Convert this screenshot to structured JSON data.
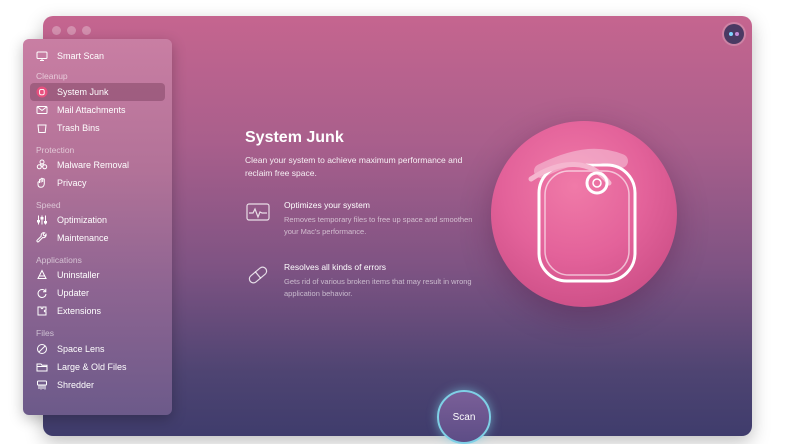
{
  "sidebar": {
    "items": [
      {
        "label": "Smart Scan",
        "icon": "monitor-icon"
      },
      {
        "label": "System Junk",
        "icon": "system-junk-icon"
      },
      {
        "label": "Mail Attachments",
        "icon": "mail-icon"
      },
      {
        "label": "Trash Bins",
        "icon": "trash-icon"
      },
      {
        "label": "Malware Removal",
        "icon": "biohazard-icon"
      },
      {
        "label": "Privacy",
        "icon": "hand-icon"
      },
      {
        "label": "Optimization",
        "icon": "sliders-icon"
      },
      {
        "label": "Maintenance",
        "icon": "wrench-icon"
      },
      {
        "label": "Uninstaller",
        "icon": "apps-icon"
      },
      {
        "label": "Updater",
        "icon": "refresh-icon"
      },
      {
        "label": "Extensions",
        "icon": "extensions-icon"
      },
      {
        "label": "Space Lens",
        "icon": "lens-icon"
      },
      {
        "label": "Large & Old Files",
        "icon": "folder-icon"
      },
      {
        "label": "Shredder",
        "icon": "shredder-icon"
      }
    ],
    "sections": {
      "cleanup": "Cleanup",
      "protection": "Protection",
      "speed": "Speed",
      "applications": "Applications",
      "files": "Files"
    }
  },
  "main": {
    "title": "System Junk",
    "description": "Clean your system to achieve maximum performance and reclaim free space.",
    "features": [
      {
        "title": "Optimizes your system",
        "description": "Removes temporary files to free up space and smoothen your Mac's performance.",
        "icon": "monitor-graph-icon"
      },
      {
        "title": "Resolves all kinds of errors",
        "description": "Gets rid of various broken items that may result in wrong application behavior.",
        "icon": "pill-icon"
      }
    ],
    "scan_label": "Scan"
  },
  "colors": {
    "accent": "#e3629a",
    "scan_ring": "#7fd0e6",
    "window_top": "#c5658f",
    "window_bottom": "#3f3c6c"
  }
}
